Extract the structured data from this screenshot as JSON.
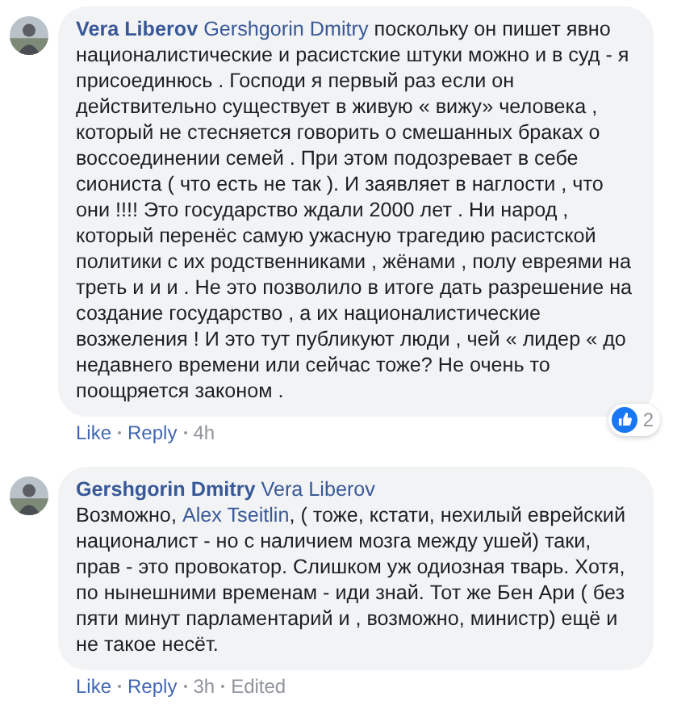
{
  "comments": [
    {
      "author": "Vera Liberov",
      "mention": "Gershgorin Dmitry",
      "body_on_new_line": false,
      "body": [
        {
          "kind": "text",
          "text": "поскольку он пишет явно националистические и расистские штуки можно и в суд - я присоединюсь . Господи я первый раз если он действительно существует в живую « вижу» человека , который не стесняется говорить о смешанных браках о воссоединении семей . При этом подозревает в себе сиониста ( что есть не так ). И заявляет в наглости , что они !!!! Это государство ждали 2000 лет . Ни народ , который перенёс самую ужасную трагедию расистской политики с их родственниками , жёнами , полу евреями на треть и и и . Не это позволило в итоге дать разрешение на создание государство , а их националистические возжеления ! И это тут публикуют люди , чей « лидер « до недавнего времени или сейчас тоже? Не очень то поощряется законом ."
        }
      ],
      "actions": [
        "Like",
        "Reply"
      ],
      "time": "4h",
      "reactions": "2"
    },
    {
      "author": "Gershgorin Dmitry",
      "mention": "Vera Liberov",
      "body_on_new_line": true,
      "body": [
        {
          "kind": "text",
          "text": "Возможно, "
        },
        {
          "kind": "link",
          "text": "Alex Tseitlin"
        },
        {
          "kind": "text",
          "text": ", ( тоже, кстати, нехилый еврейский националист - но с наличием мозга между ушей) таки, прав - это провокатор. Слишком уж одиозная тварь. Хотя, по нынешними временам - иди знай. Тот же Бен Ари ( без пяти минут парламентарий и , возможно, министр) ещё и не такое несёт."
        }
      ],
      "actions": [
        "Like",
        "Reply"
      ],
      "time": "3h",
      "edited": "Edited"
    }
  ]
}
